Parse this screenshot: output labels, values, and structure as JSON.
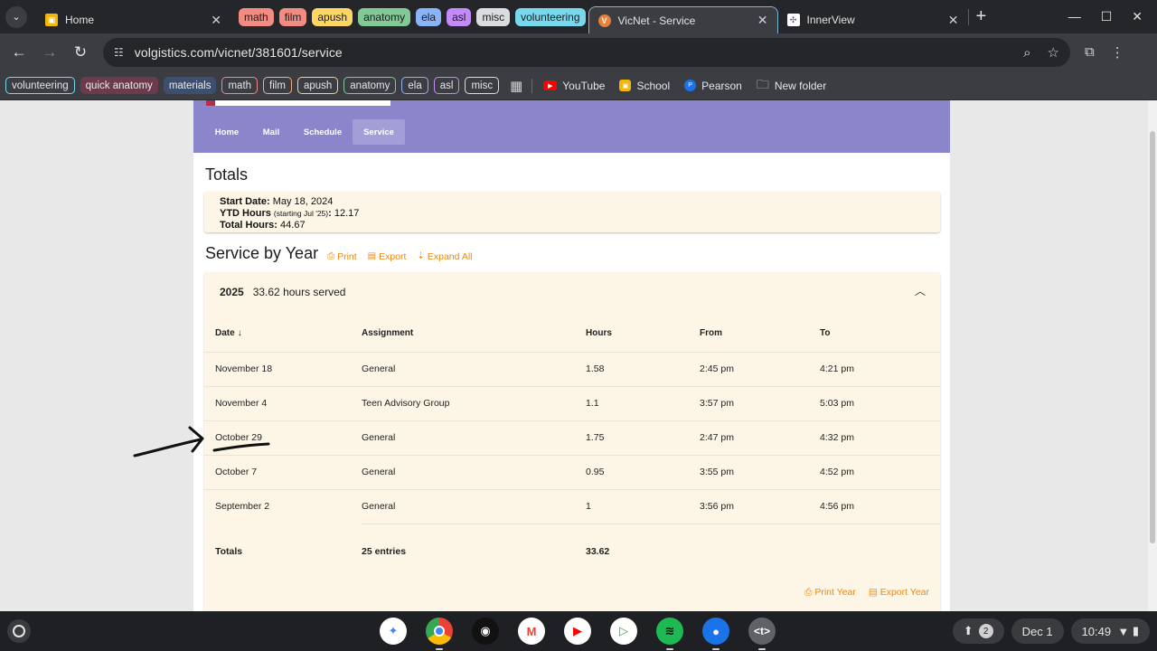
{
  "browser": {
    "tabs": {
      "home": {
        "title": "Home"
      },
      "active": {
        "title": "VicNet - Service"
      },
      "inner": {
        "title": "InnerView"
      }
    },
    "tab_groups": [
      {
        "label": "math",
        "color": "#f28b82"
      },
      {
        "label": "film",
        "color": "#f28b82"
      },
      {
        "label": "apush",
        "color": "#fdd663"
      },
      {
        "label": "anatomy",
        "color": "#81c995"
      },
      {
        "label": "ela",
        "color": "#8ab4f8"
      },
      {
        "label": "asl",
        "color": "#c58af9"
      },
      {
        "label": "misc",
        "color": "#dadce0"
      },
      {
        "label": "volunteering",
        "color": "#78d9ec"
      }
    ],
    "url": "volgistics.com/vicnet/381601/service",
    "bookmark_groups": [
      {
        "label": "volunteering",
        "color": "#78d9ec",
        "style": "outline"
      },
      {
        "label": "quick anatomy",
        "color": "#6b3b4d",
        "style": "filled"
      },
      {
        "label": "materials",
        "color": "#3d4f6e",
        "style": "filled"
      },
      {
        "label": "math",
        "color": "#f28b82",
        "style": "outline"
      },
      {
        "label": "film",
        "color": "#f6ae84",
        "style": "outline"
      },
      {
        "label": "apush",
        "color": "#fdd663",
        "style": "outline"
      },
      {
        "label": "anatomy",
        "color": "#81c995",
        "style": "outline"
      },
      {
        "label": "ela",
        "color": "#8ab4f8",
        "style": "outline"
      },
      {
        "label": "asl",
        "color": "#c58af9",
        "style": "outline"
      },
      {
        "label": "misc",
        "color": "#dadce0",
        "style": "outline"
      }
    ],
    "bookmark_links": {
      "youtube": "YouTube",
      "school": "School",
      "pearson": "Pearson",
      "new_folder": "New folder"
    }
  },
  "site": {
    "nav": {
      "home": "Home",
      "mail": "Mail",
      "schedule": "Schedule",
      "service": "Service"
    },
    "totals": {
      "heading": "Totals",
      "start_label": "Start Date:",
      "start_value": "May 18, 2024",
      "ytd_label": "YTD Hours",
      "ytd_note": "(starting Jul '25)",
      "ytd_colon": ":",
      "ytd_value": "12.17",
      "total_label": "Total Hours:",
      "total_value": "44.67"
    },
    "service": {
      "heading": "Service by Year",
      "print": "Print",
      "export": "Export",
      "expand_all": "Expand All",
      "year": "2025",
      "year_hours": "33.62 hours served",
      "columns": {
        "date": "Date",
        "assignment": "Assignment",
        "hours": "Hours",
        "from": "From",
        "to": "To"
      },
      "rows": [
        {
          "date": "November 18",
          "assignment": "General",
          "hours": "1.58",
          "from": "2:45 pm",
          "to": "4:21 pm"
        },
        {
          "date": "November 4",
          "assignment": "Teen Advisory Group",
          "hours": "1.1",
          "from": "3:57 pm",
          "to": "5:03 pm"
        },
        {
          "date": "October 29",
          "assignment": "General",
          "hours": "1.75",
          "from": "2:47 pm",
          "to": "4:32 pm"
        },
        {
          "date": "October 7",
          "assignment": "General",
          "hours": "0.95",
          "from": "3:55 pm",
          "to": "4:52 pm"
        },
        {
          "date": "September 2",
          "assignment": "General",
          "hours": "1",
          "from": "3:56 pm",
          "to": "4:56 pm"
        }
      ],
      "totals_label": "Totals",
      "totals_entries": "25 entries",
      "totals_hours": "33.62",
      "print_year": "Print Year",
      "export_year": "Export Year"
    }
  },
  "shelf": {
    "notifications_count": "2",
    "date": "Dec 1",
    "time": "10:49"
  },
  "colors": {
    "accent_orange": "#e98a12",
    "banner_purple": "#8b85cc",
    "card_cream": "#fdf6e6"
  }
}
